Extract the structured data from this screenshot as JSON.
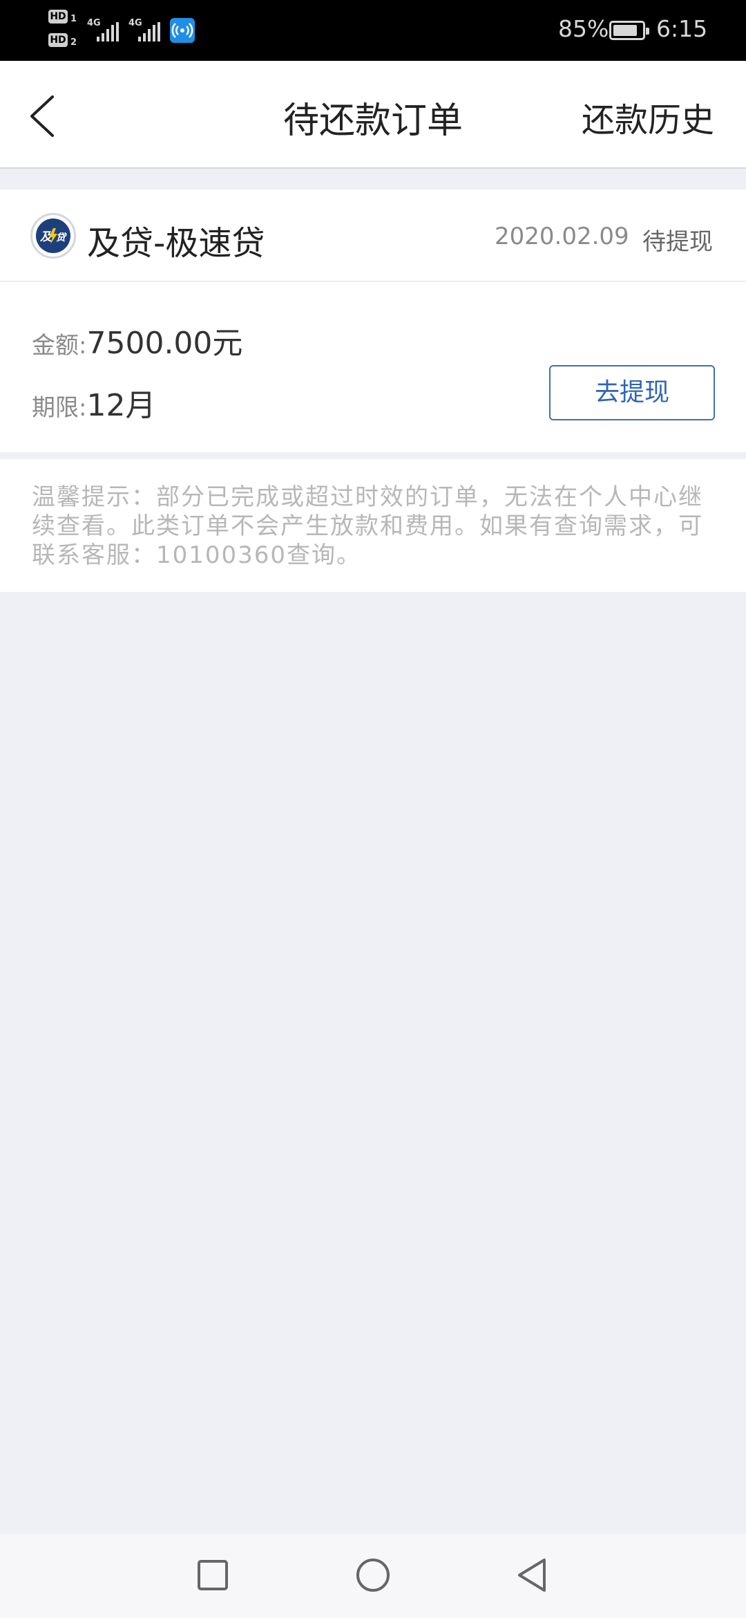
{
  "status_bar": {
    "hd1_sub": "1",
    "hd2_sub": "2",
    "hd_label": "HD",
    "sim1_network": "4G",
    "sim2_network": "4G",
    "battery_percent": "85%",
    "battery_level": 0.85,
    "time": "6:15",
    "hotspot_icon": "wifi-hotspot-icon"
  },
  "title_bar": {
    "back_icon": "chevron-left-icon",
    "title": "待还款订单",
    "history_link": "还款历史"
  },
  "order": {
    "logo_icon": "lender-logo-icon",
    "product_name": "及贷-极速贷",
    "date": "2020.02.09",
    "status": "待提现",
    "amount_label": "金额:",
    "amount_value": "7500.00元",
    "term_label": "期限:",
    "term_value": "12月",
    "action_button": "去提现"
  },
  "notice": {
    "text": "温馨提示：部分已完成或超过时效的订单，无法在个人中心继续查看。此类订单不会产生放款和费用。如果有查询需求，可联系客服：10100360查询。"
  },
  "nav_bar": {
    "recent_icon": "square-recent-apps-icon",
    "home_icon": "circle-home-icon",
    "back_icon": "triangle-back-icon"
  },
  "colors": {
    "accent": "#2f64b4",
    "page_background": "#eff0f5",
    "logo_background": "#1d3f7c"
  }
}
